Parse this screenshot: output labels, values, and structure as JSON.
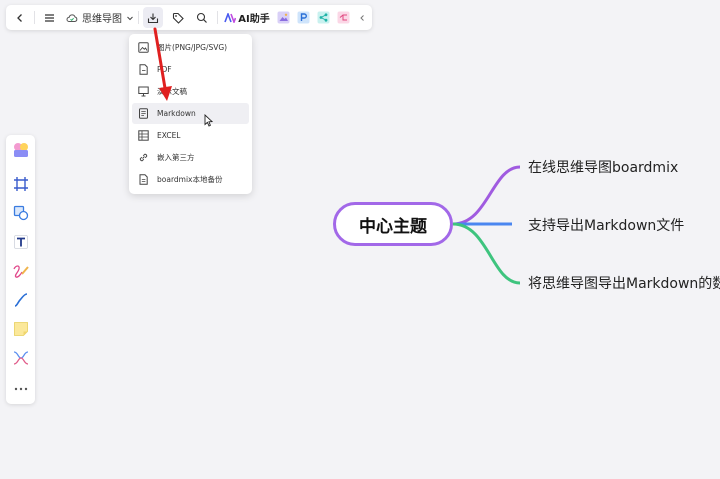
{
  "toolbar": {
    "doc_type_label": "思维导图",
    "ai_label": "AI助手"
  },
  "export_menu": {
    "items": [
      {
        "label": "图片(PNG/JPG/SVG)",
        "icon": "image-icon"
      },
      {
        "label": "PDF",
        "icon": "pdf-file-icon"
      },
      {
        "label": "演示文稿",
        "icon": "presentation-icon"
      },
      {
        "label": "Markdown",
        "icon": "markdown-file-icon"
      },
      {
        "label": "EXCEL",
        "icon": "table-icon"
      },
      {
        "label": "嵌入第三方",
        "icon": "link-icon"
      },
      {
        "label": "boardmix本地备份",
        "icon": "backup-file-icon"
      }
    ]
  },
  "mindmap": {
    "root": "中心主题",
    "children": [
      "在线思维导图boardmix",
      "支持导出Markdown文件",
      "将思维导图导出Markdown的数"
    ]
  },
  "colors": {
    "branch_1": "#a05be0",
    "branch_2": "#4a86f0",
    "branch_3": "#3ec47e",
    "annotation_arrow": "#e02020"
  }
}
